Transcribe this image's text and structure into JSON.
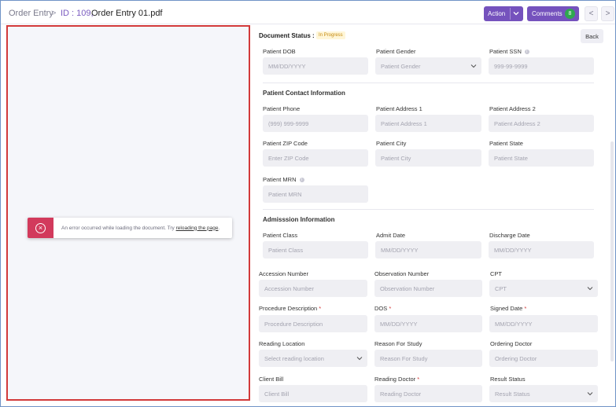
{
  "header": {
    "breadcrumb_root": "Order Entry",
    "breadcrumb_sep": ">",
    "breadcrumb_id": "ID : 109,",
    "breadcrumb_file": "Order Entry 01.pdf",
    "action_label": "Action",
    "comments_label": "Comments",
    "comments_count": "8",
    "prev_icon": "<",
    "next_icon": ">"
  },
  "viewer": {
    "error_text": "An error occurred while loading the document. Try",
    "error_link": "reloading the page",
    "error_tail": ".",
    "error_icon": "×"
  },
  "status": {
    "label": "Document Status :",
    "value": "In Progress",
    "back_label": "Back"
  },
  "sections": {
    "contact": "Patient Contact Information",
    "admission": "Admisssion Information"
  },
  "fields": {
    "patient_dob": {
      "label": "Patient DOB",
      "placeholder": "MM/DD/YYYY"
    },
    "patient_gender": {
      "label": "Patient Gender",
      "placeholder": "Patient Gender"
    },
    "patient_ssn": {
      "label": "Patient SSN",
      "placeholder": "999-99-9999"
    },
    "patient_phone": {
      "label": "Patient Phone",
      "placeholder": "(999) 999-9999"
    },
    "patient_address1": {
      "label": "Patient Address 1",
      "placeholder": "Patient Address 1"
    },
    "patient_address2": {
      "label": "Patient Address 2",
      "placeholder": "Patient Address 2"
    },
    "patient_zip": {
      "label": "Patient ZIP Code",
      "placeholder": "Enter ZIP Code"
    },
    "patient_city": {
      "label": "Patient City",
      "placeholder": "Patient City"
    },
    "patient_state": {
      "label": "Patient State",
      "placeholder": "Patient State"
    },
    "patient_mrn": {
      "label": "Patient MRN",
      "placeholder": "Patient MRN"
    },
    "patient_class": {
      "label": "Patient Class",
      "placeholder": "Patient Class"
    },
    "admit_date": {
      "label": "Admit Date",
      "placeholder": "MM/DD/YYYY"
    },
    "discharge_date": {
      "label": "Discharge Date",
      "placeholder": "MM/DD/YYYY"
    },
    "accession_number": {
      "label": "Accession Number",
      "placeholder": "Accession Number"
    },
    "observation_number": {
      "label": "Observation Number",
      "placeholder": "Observation Number"
    },
    "cpt": {
      "label": "CPT",
      "placeholder": "CPT"
    },
    "procedure_description": {
      "label": "Procedure Description",
      "placeholder": "Procedure Description",
      "required": "*"
    },
    "dos": {
      "label": "DOS",
      "placeholder": "MM/DD/YYYY",
      "required": "*"
    },
    "signed_date": {
      "label": "Signed Date",
      "placeholder": "MM/DD/YYYY",
      "required": "*"
    },
    "reading_location": {
      "label": "Reading Location",
      "placeholder": "Select reading location"
    },
    "reason_for_study": {
      "label": "Reason For Study",
      "placeholder": "Reason For Study"
    },
    "ordering_doctor": {
      "label": "Ordering Doctor",
      "placeholder": "Ordering Doctor"
    },
    "client_bill": {
      "label": "Client Bill",
      "placeholder": "Client Bill"
    },
    "reading_doctor": {
      "label": "Reading Doctor",
      "placeholder": "Reading Doctor",
      "required": "*"
    },
    "result_status": {
      "label": "Result Status",
      "placeholder": "Result Status"
    }
  },
  "info_icon": "i"
}
